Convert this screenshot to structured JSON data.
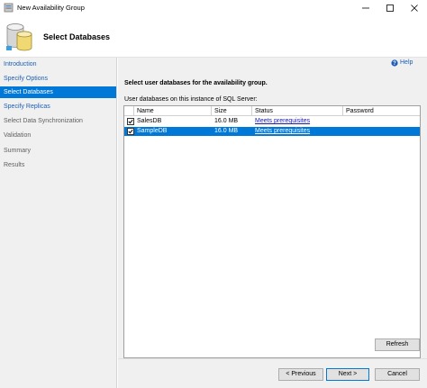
{
  "window": {
    "title": "New Availability Group"
  },
  "header": {
    "title": "Select Databases"
  },
  "help": {
    "label": "Help"
  },
  "sidebar": {
    "items": [
      {
        "label": "Introduction",
        "state": "link"
      },
      {
        "label": "Specify Options",
        "state": "link"
      },
      {
        "label": "Select Databases",
        "state": "active"
      },
      {
        "label": "Specify Replicas",
        "state": "link"
      },
      {
        "label": "Select Data Synchronization",
        "state": "disabled"
      },
      {
        "label": "Validation",
        "state": "disabled"
      },
      {
        "label": "Summary",
        "state": "disabled"
      },
      {
        "label": "Results",
        "state": "disabled"
      }
    ]
  },
  "main": {
    "instruction": "Select user databases for the availability group.",
    "grid_label": "User databases on this instance of SQL Server:",
    "columns": [
      "Name",
      "Size",
      "Status",
      "Password"
    ],
    "rows": [
      {
        "checked": true,
        "name": "SalesDB",
        "size": "16.0 MB",
        "status": "Meets prerequisites",
        "password": ""
      },
      {
        "checked": true,
        "name": "SampleDB",
        "size": "16.0 MB",
        "status": "Meets prerequisites",
        "password": ""
      }
    ]
  },
  "buttons": {
    "refresh": "Refresh",
    "previous": "< Previous",
    "next": "Next >",
    "cancel": "Cancel"
  },
  "colors": {
    "accent": "#0078d7",
    "link": "#1a5fb4"
  }
}
